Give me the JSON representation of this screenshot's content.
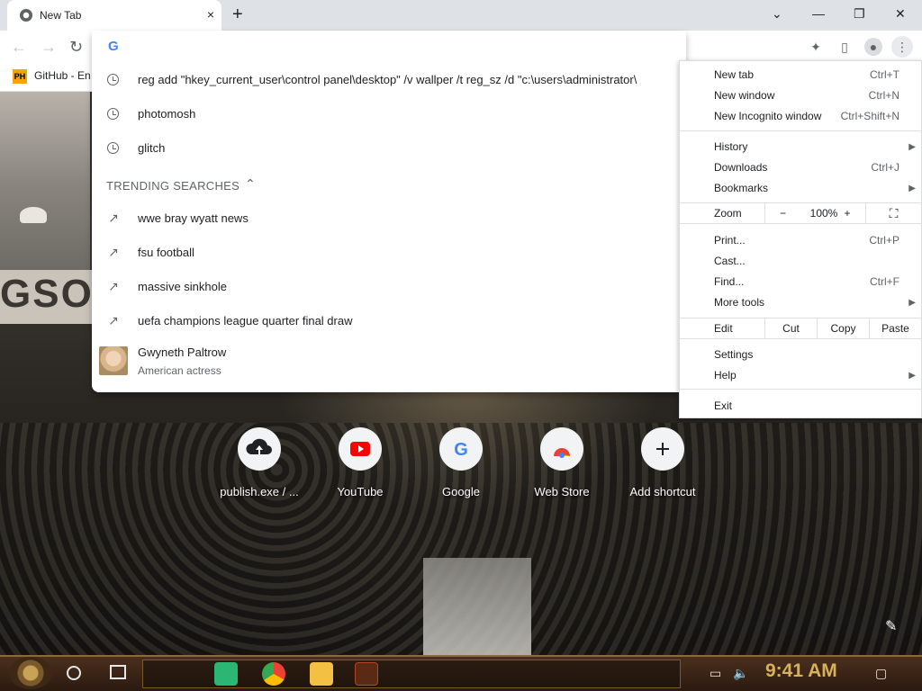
{
  "browser": {
    "tab_title": "New Tab",
    "tab_close": "×",
    "new_tab": "+",
    "window_controls": {
      "dropdown": "⌄",
      "minimize": "—",
      "restore": "❐",
      "close": "✕"
    }
  },
  "toolbar": {
    "back": "←",
    "forward": "→",
    "reload": "↻",
    "omnibox_value": "",
    "google_mark": "G"
  },
  "bookmarks": [
    {
      "badge": "PH",
      "label": "GitHub - Enc"
    }
  ],
  "omnibox": {
    "history": [
      "reg add \"hkey_current_user\\control panel\\desktop\" /v wallper /t reg_sz /d \"c:\\users\\administrator\\",
      "photomosh",
      "glitch"
    ],
    "trending_header": "TRENDING SEARCHES",
    "trending_caret": "⌃",
    "trending": [
      "wwe bray wyatt news",
      "fsu football",
      "massive sinkhole",
      "uefa champions league quarter final draw"
    ],
    "entity": {
      "name": "Gwyneth Paltrow",
      "subtitle": "American actress"
    }
  },
  "menu": {
    "items_top": [
      {
        "label": "New tab",
        "shortcut": "Ctrl+T"
      },
      {
        "label": "New window",
        "shortcut": "Ctrl+N"
      },
      {
        "label": "New Incognito window",
        "shortcut": "Ctrl+Shift+N"
      }
    ],
    "items_mid": [
      {
        "label": "History",
        "shortcut": "",
        "arrow": "▶"
      },
      {
        "label": "Downloads",
        "shortcut": "Ctrl+J",
        "arrow": ""
      },
      {
        "label": "Bookmarks",
        "shortcut": "",
        "arrow": "▶"
      }
    ],
    "zoom": {
      "label": "Zoom",
      "minus": "−",
      "value": "100%",
      "plus": "+",
      "fullscreen": "⛶"
    },
    "items_tools": [
      {
        "label": "Print...",
        "shortcut": "Ctrl+P",
        "arrow": ""
      },
      {
        "label": "Cast...",
        "shortcut": "",
        "arrow": ""
      },
      {
        "label": "Find...",
        "shortcut": "Ctrl+F",
        "arrow": ""
      },
      {
        "label": "More tools",
        "shortcut": "",
        "arrow": "▶"
      }
    ],
    "edit": {
      "label": "Edit",
      "cut": "Cut",
      "copy": "Copy",
      "paste": "Paste"
    },
    "items_settings": [
      {
        "label": "Settings",
        "arrow": ""
      },
      {
        "label": "Help",
        "arrow": "▶"
      }
    ],
    "exit": "Exit"
  },
  "shortcuts": [
    {
      "label": "publish.exe / ...",
      "icon": "upload-cloud-icon"
    },
    {
      "label": "YouTube",
      "icon": "youtube-icon"
    },
    {
      "label": "Google",
      "icon": "google-icon"
    },
    {
      "label": "Web Store",
      "icon": "webstore-icon"
    },
    {
      "label": "Add shortcut",
      "icon": "plus-icon"
    }
  ],
  "wallpaper": {
    "sign_text": "GSO"
  },
  "taskbar": {
    "time": "9:41 AM"
  },
  "colors": {
    "accent": "#1a73e8",
    "taskbar_clock": "#d8b25a"
  }
}
